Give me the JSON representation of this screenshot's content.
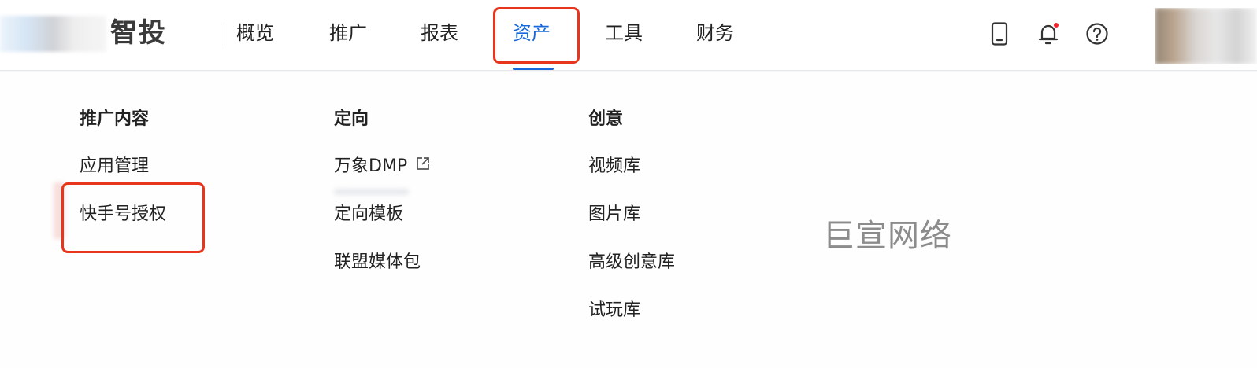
{
  "brand": {
    "name": "智投"
  },
  "nav": {
    "items": [
      {
        "label": "概览"
      },
      {
        "label": "推广"
      },
      {
        "label": "报表"
      },
      {
        "label": "资产"
      },
      {
        "label": "工具"
      },
      {
        "label": "财务"
      }
    ],
    "active": "资产"
  },
  "header_icons": [
    "mobile-icon",
    "bell-icon",
    "help-icon"
  ],
  "menu": {
    "columns": [
      {
        "title": "推广内容",
        "items": [
          {
            "label": "应用管理"
          },
          {
            "label": "快手号授权"
          }
        ]
      },
      {
        "title": "定向",
        "items": [
          {
            "label": "万象DMP",
            "icon": "external-link-icon"
          },
          {
            "label": "定向模板"
          },
          {
            "label": "联盟媒体包"
          }
        ]
      },
      {
        "title": "创意",
        "items": [
          {
            "label": "视频库"
          },
          {
            "label": "图片库"
          },
          {
            "label": "高级创意库"
          },
          {
            "label": "试玩库"
          }
        ]
      }
    ]
  },
  "watermark": "巨宣网络",
  "colors": {
    "accent": "#1668dc",
    "highlight_box": "#e8351e",
    "notification_dot": "#f5222d"
  }
}
